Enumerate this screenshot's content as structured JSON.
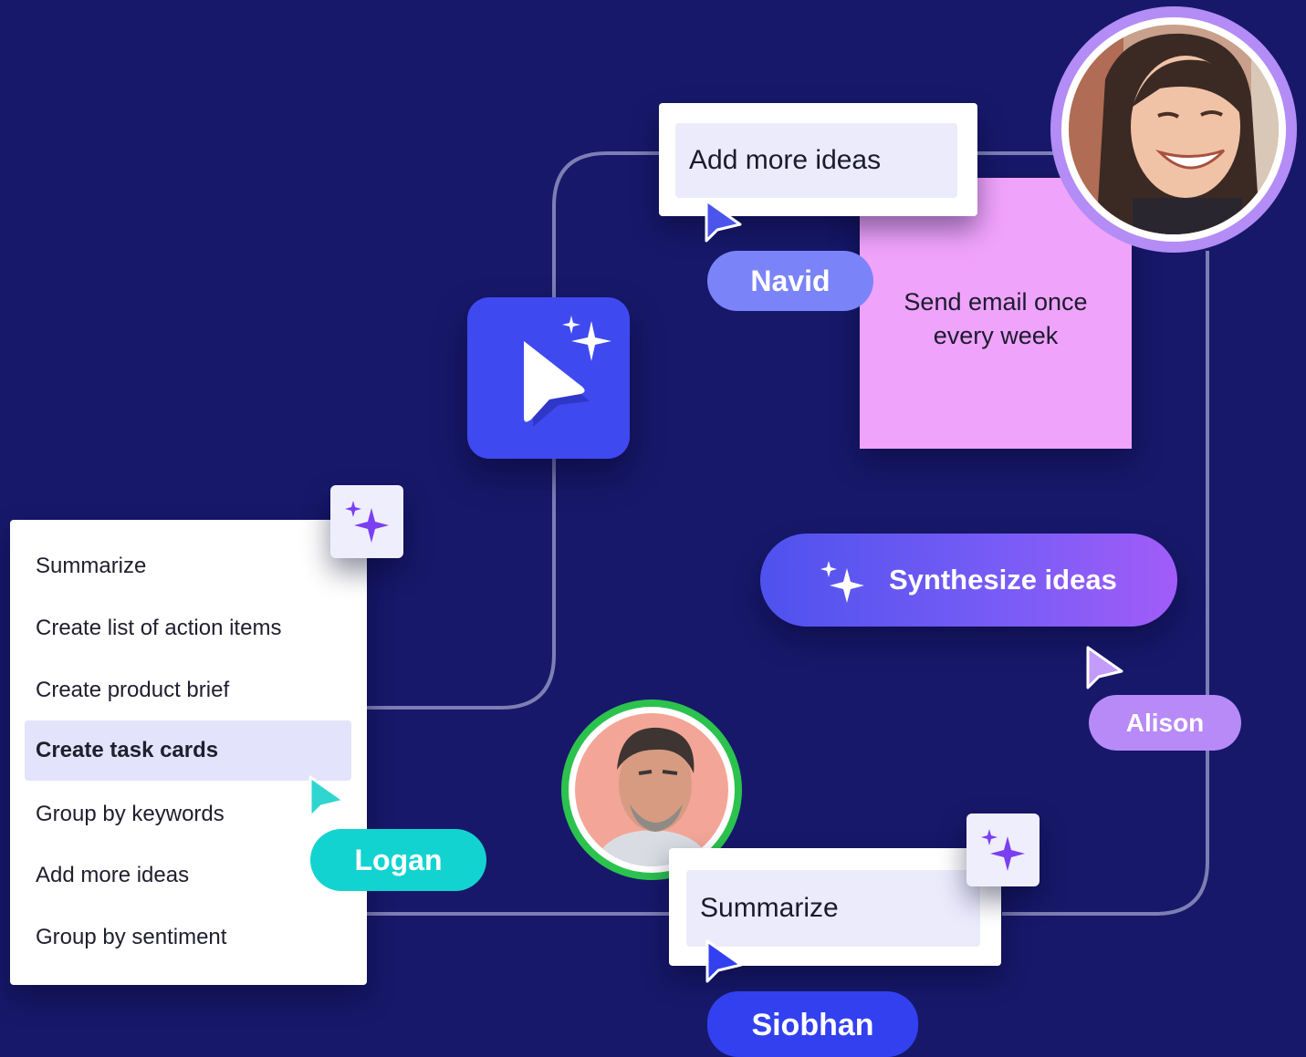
{
  "colors": {
    "background": "#17186a",
    "navid": "#7b83f8",
    "logan": "#13d3d1",
    "alison": "#b78af7",
    "siobhan": "#3240f0",
    "sticky": "#f0a3fb",
    "app_icon": "#3f49f0",
    "sparkle": "#7b3ff2"
  },
  "top_card": {
    "text": "Add more ideas"
  },
  "sticky_note": {
    "text": "Send email once every week"
  },
  "synthesize_button": {
    "label": "Synthesize ideas",
    "icon": "sparkle-icon"
  },
  "bottom_card": {
    "text": "Summarize"
  },
  "menu": {
    "items": [
      {
        "label": "Summarize"
      },
      {
        "label": "Create list of action items"
      },
      {
        "label": "Create product brief"
      },
      {
        "label": "Create task cards",
        "selected": true
      },
      {
        "label": "Group by  keywords"
      },
      {
        "label": "Add more ideas"
      },
      {
        "label": "Group by sentiment"
      }
    ]
  },
  "collaborators": {
    "navid": "Navid",
    "logan": "Logan",
    "alison": "Alison",
    "siobhan": "Siobhan"
  },
  "icons": {
    "app_icon": "ai-cursor-icon",
    "sparkle": "sparkle-icon",
    "cursor": "cursor-arrow-icon"
  }
}
